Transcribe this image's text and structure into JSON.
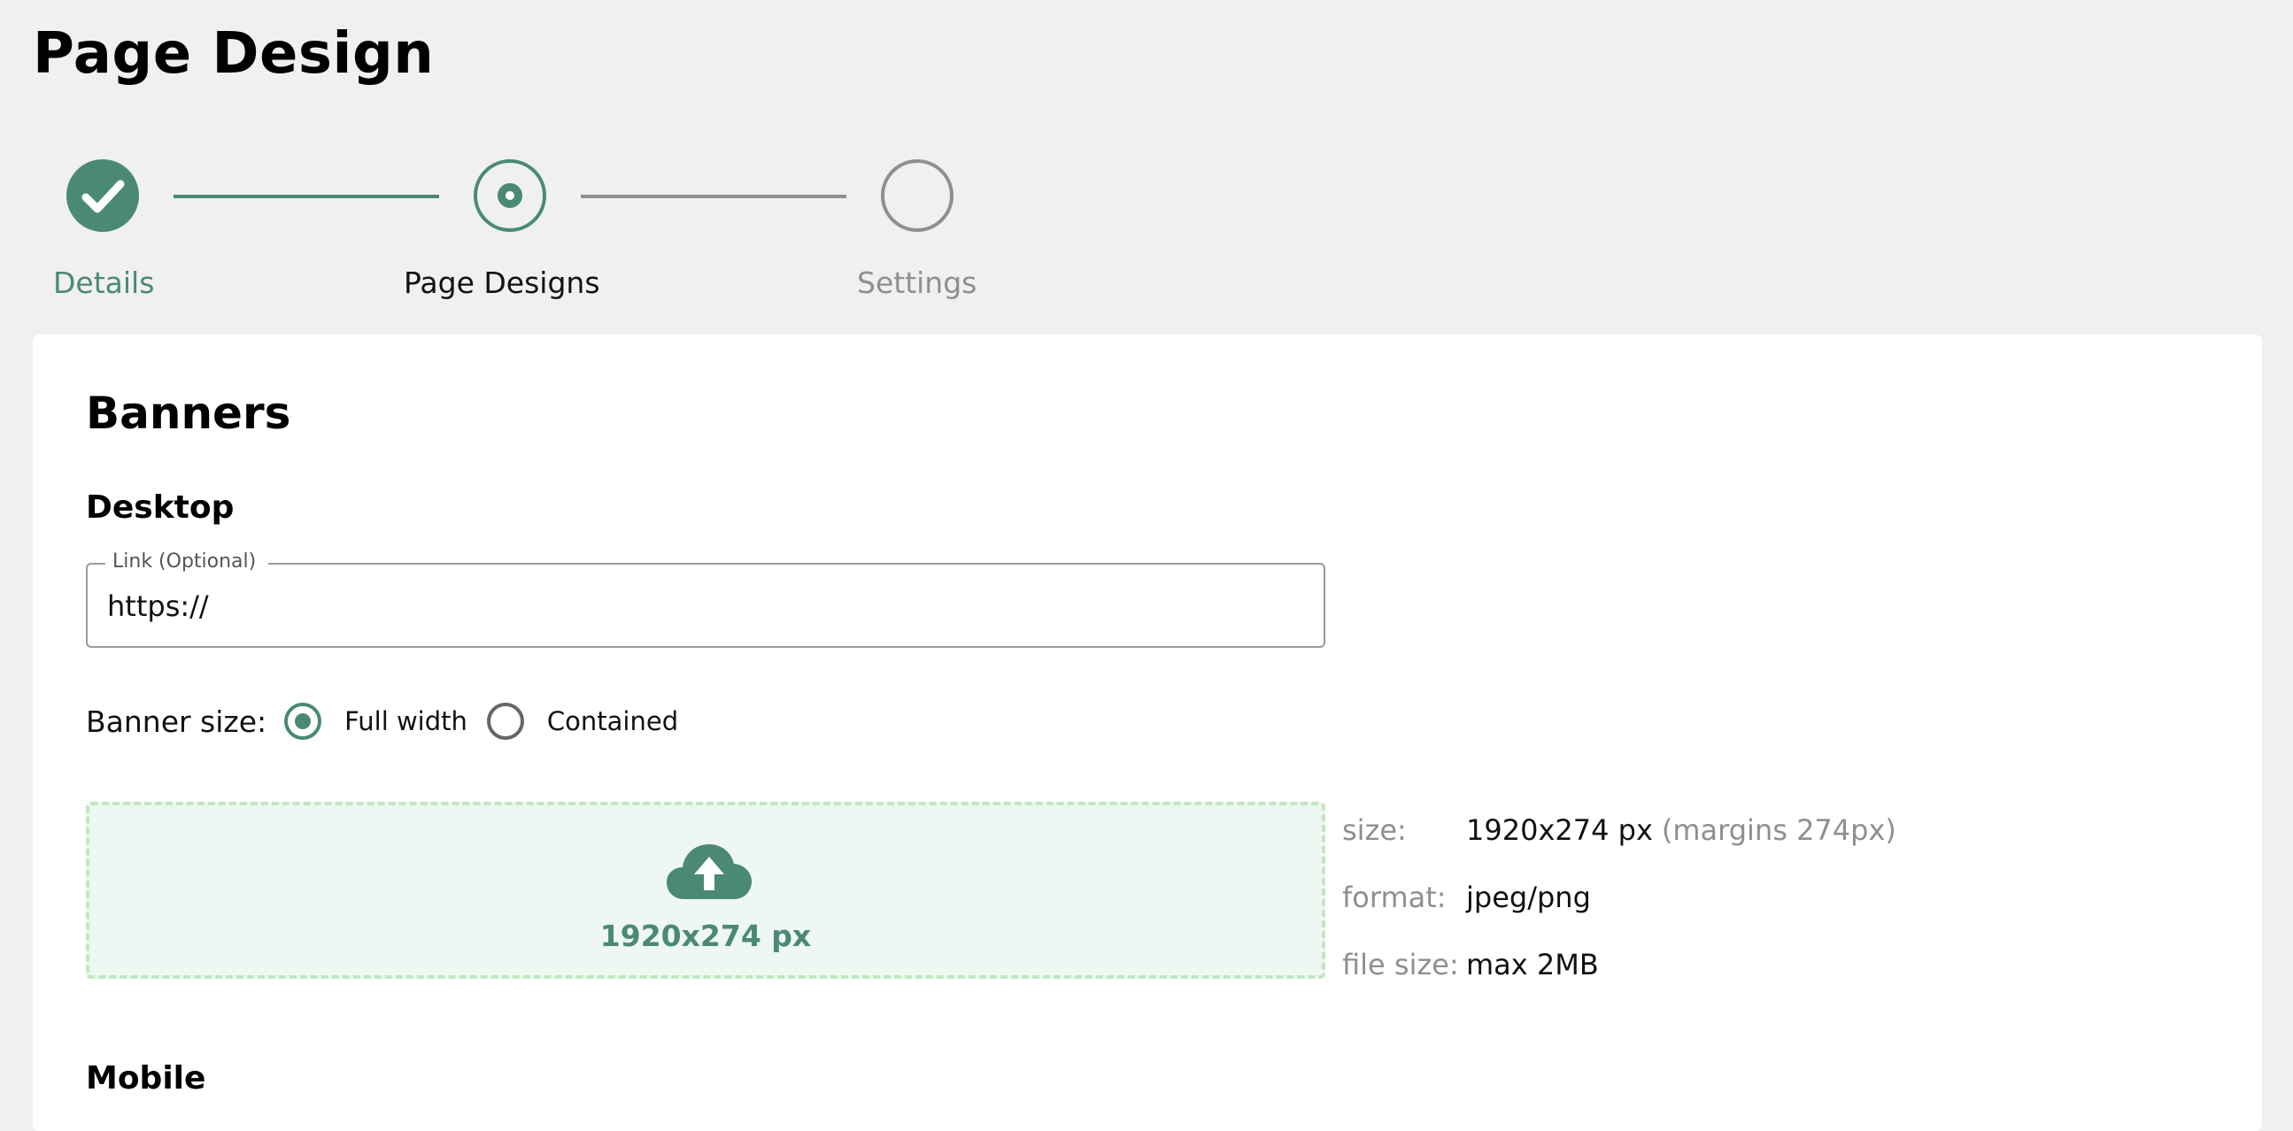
{
  "page": {
    "title": "Page Design"
  },
  "stepper": {
    "steps": [
      {
        "label": "Details",
        "state": "done"
      },
      {
        "label": "Page Designs",
        "state": "active"
      },
      {
        "label": "Settings",
        "state": "pending"
      }
    ]
  },
  "banners": {
    "title": "Banners",
    "desktop": {
      "title": "Desktop",
      "link": {
        "legend": "Link (Optional)",
        "value": "https://"
      },
      "banner_size": {
        "label": "Banner size:",
        "options": [
          {
            "label": "Full width",
            "selected": true
          },
          {
            "label": "Contained",
            "selected": false
          }
        ]
      },
      "upload": {
        "icon": "cloud-upload-icon",
        "size_text": "1920x274 px"
      },
      "specs": {
        "size_key": "size:",
        "size_value": "1920x274 px",
        "size_note": "(margins 274px)",
        "format_key": "format:",
        "format_value": "jpeg/png",
        "filesize_key": "file size:",
        "filesize_value": "max 2MB"
      }
    },
    "mobile": {
      "title": "Mobile"
    }
  },
  "colors": {
    "accent": "#4a8a72",
    "inactive": "#8f8f8f",
    "upload_bg": "#eef7f2",
    "upload_border": "#bfe8bf"
  }
}
